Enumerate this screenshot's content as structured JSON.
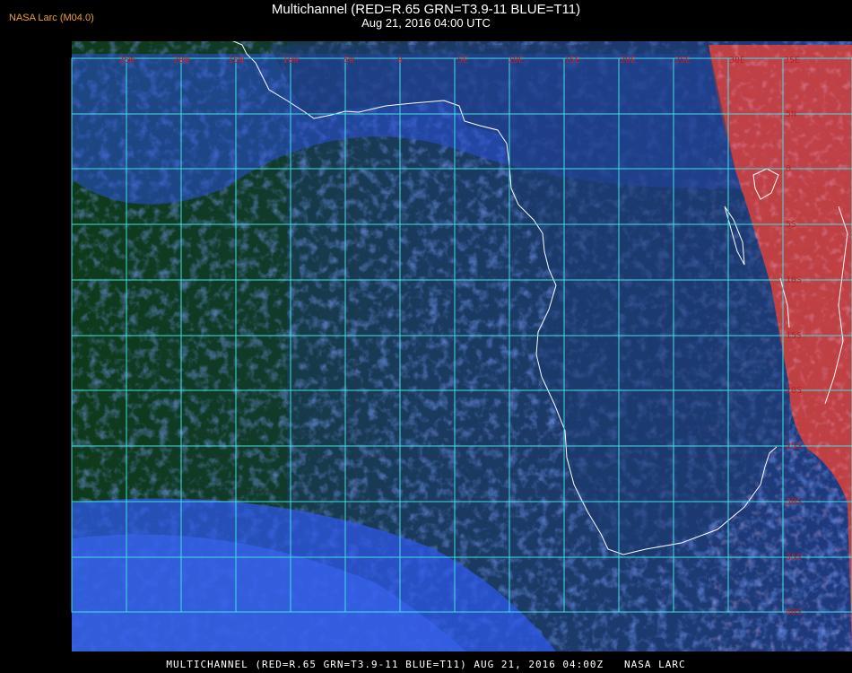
{
  "header": {
    "source": "NASA Larc (M04.0)",
    "title": "Multichannel (RED=R.65 GRN=T3.9-11 BLUE=T11)",
    "datetime": "Aug 21, 2016 04:00 UTC"
  },
  "footer": {
    "caption": "MULTICHANNEL (RED=R.65 GRN=T3.9-11 BLUE=T11) AUG 21, 2016 04:00Z   NASA LARC"
  },
  "map": {
    "longitude_labels": [
      "25W",
      "20W",
      "15W",
      "10W",
      "5W",
      "0",
      "5E",
      "10E",
      "15E",
      "20E",
      "25E",
      "30E",
      "35E"
    ],
    "latitude_labels": [
      "5N",
      "0",
      "5S",
      "10S",
      "15S",
      "20S",
      "25S",
      "30S",
      "35S",
      "40S"
    ],
    "colors": {
      "grid": "#40e0e0",
      "coastline": "#ffffff",
      "label": "#c02020",
      "ocean": "#1a3a6a",
      "cloud": "#3060f0",
      "land_hot": "#d84848"
    }
  }
}
